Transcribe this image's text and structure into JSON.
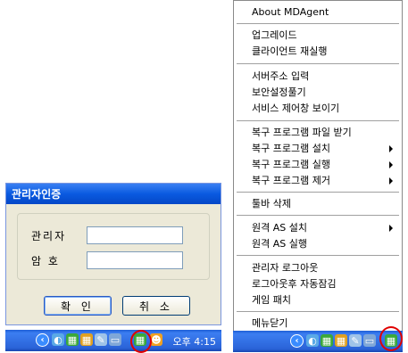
{
  "auth_dialog": {
    "title": "관리자인증",
    "admin_label": "관리자",
    "password_label": "암 호",
    "admin_value": "",
    "password_value": "",
    "ok_label": "확 인",
    "cancel_label": "취 소"
  },
  "taskbar_left": {
    "clock": "오후 4:15"
  },
  "context_menu": {
    "items": [
      {
        "label": "About MDAgent"
      },
      {
        "label": "업그레이드"
      },
      {
        "label": "클라이언트 재실행"
      },
      {
        "label": "서버주소 입력"
      },
      {
        "label": "보안설정풀기"
      },
      {
        "label": "서비스 제어창 보이기"
      },
      {
        "label": "복구 프로그램 파일 받기"
      },
      {
        "label": "복구 프로그램 설치"
      },
      {
        "label": "복구 프로그램 실행"
      },
      {
        "label": "복구 프로그램 제거"
      },
      {
        "label": "툴바 삭제"
      },
      {
        "label": "원격 AS 설치"
      },
      {
        "label": "원격 AS 실행"
      },
      {
        "label": "관리자 로그아웃"
      },
      {
        "label": "로그아웃후 자동잠김"
      },
      {
        "label": "게임 패치"
      },
      {
        "label": "메뉴닫기"
      }
    ]
  },
  "icons": [
    "back-arrow-icon",
    "network-icon",
    "grid-app-icon",
    "edit-icon",
    "monitor-icon",
    "mdagent-tray-icon",
    "user-icon"
  ],
  "colors": {
    "titlebar": "#0a5ae0",
    "taskbar": "#2a63d8",
    "highlight_circle": "#e00000"
  }
}
